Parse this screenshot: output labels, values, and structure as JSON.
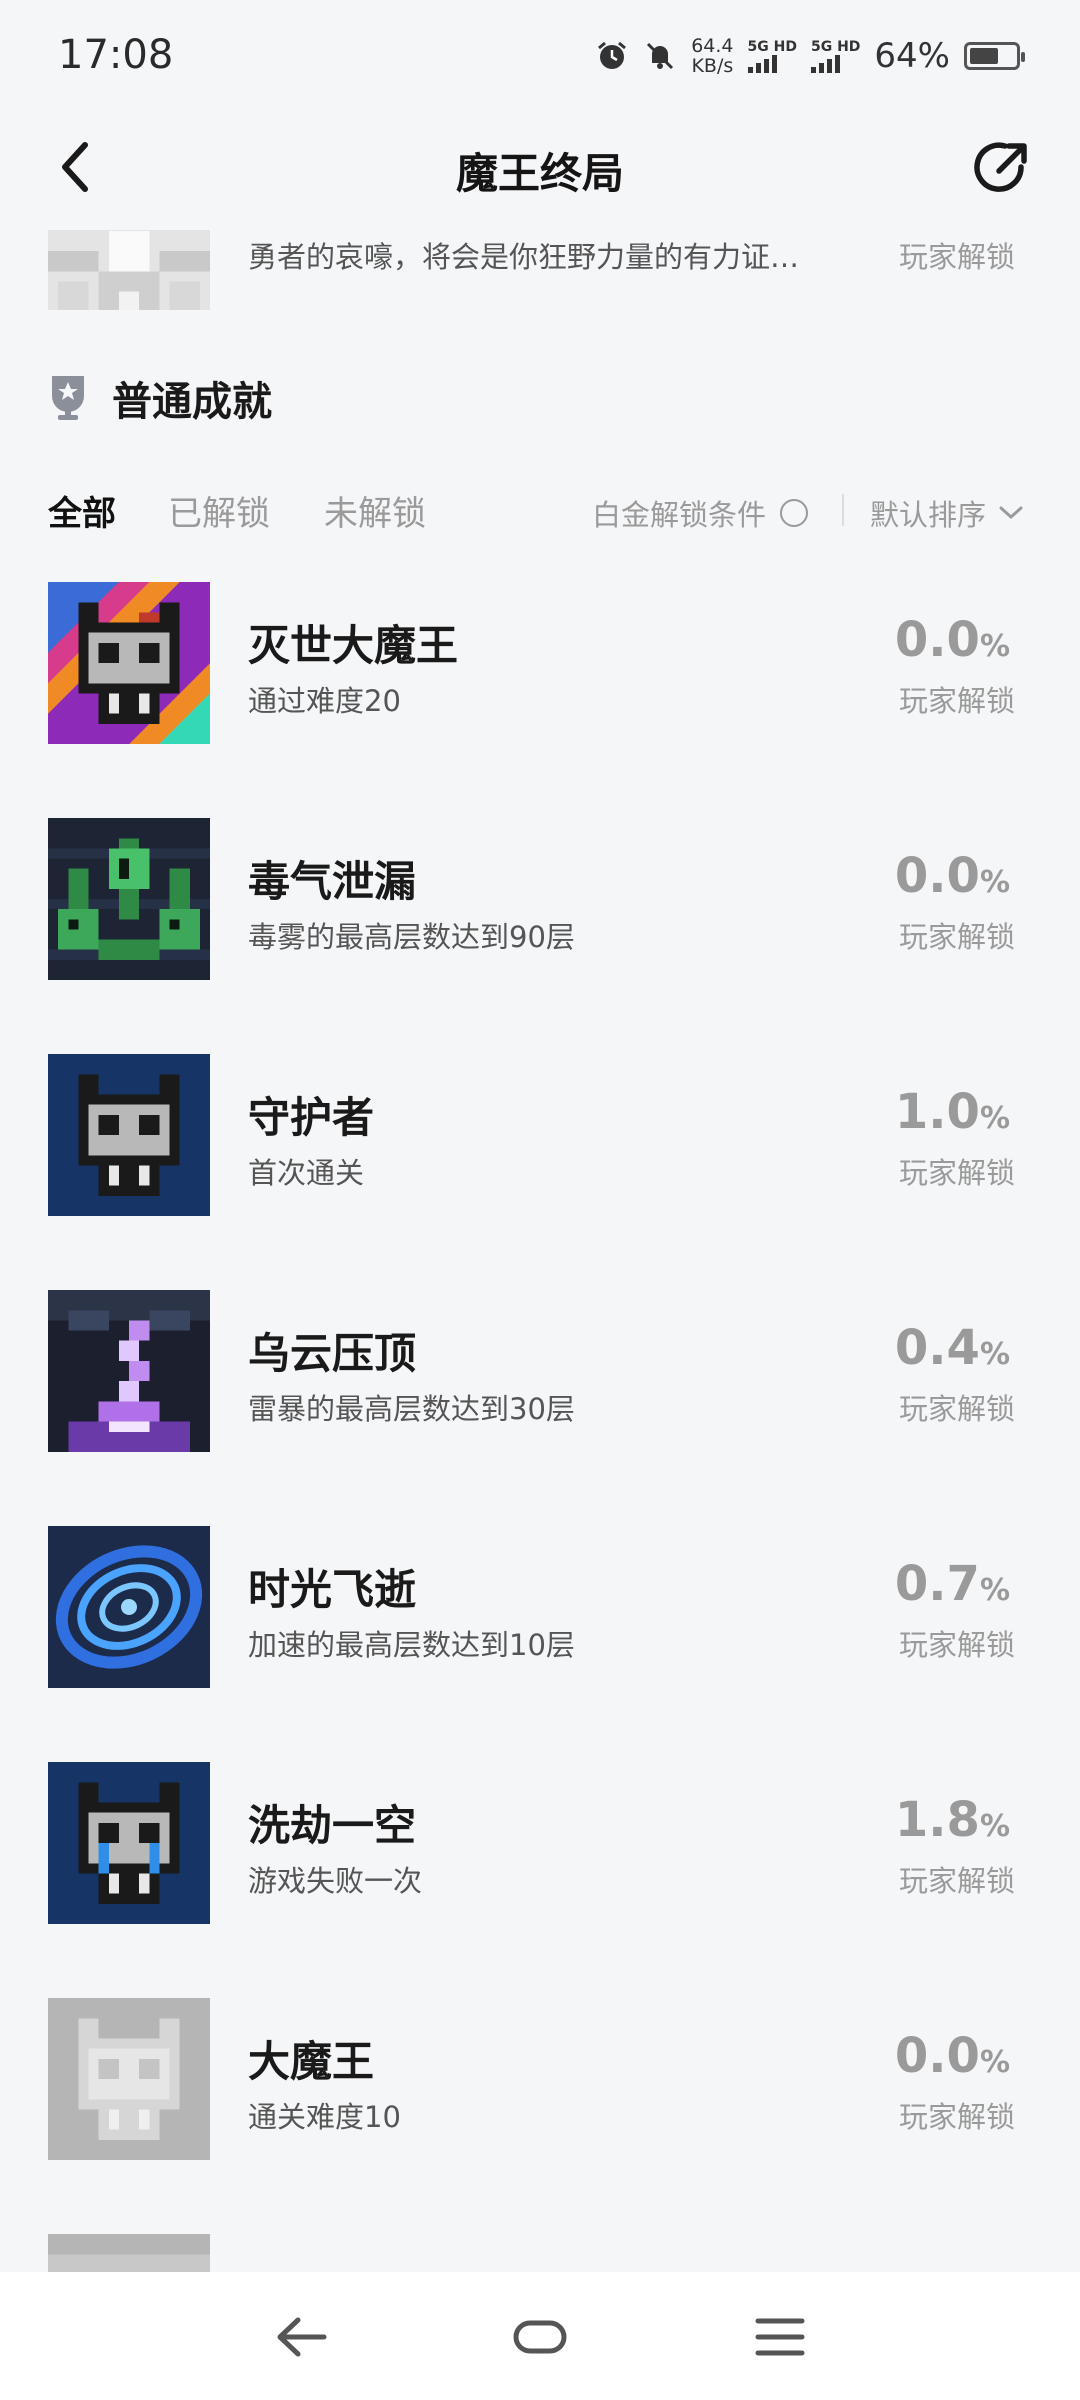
{
  "status_bar": {
    "time": "17:08",
    "net_speed_value": "64.4",
    "net_speed_unit": "KB/s",
    "sim1": "5G HD",
    "sim2": "5G HD",
    "battery": "64%",
    "battery_level": 0.64
  },
  "header": {
    "title": "魔王终局"
  },
  "partial_item": {
    "description": "勇者的哀嚎，将会是你狂野力量的有力证…",
    "status": "玩家解锁"
  },
  "section": {
    "title": "普通成就"
  },
  "filters": {
    "tabs": [
      "全部",
      "已解锁",
      "未解锁"
    ],
    "active_tab": "全部",
    "platinum_condition": "白金解锁条件",
    "sort": "默认排序"
  },
  "achievements": [
    {
      "name": "灭世大魔王",
      "description": "通过难度20",
      "percent": "0.0",
      "unit": "%",
      "status": "玩家解锁",
      "icon": "skull-rainbow-icon"
    },
    {
      "name": "毒气泄漏",
      "description": "毒雾的最高层数达到90层",
      "percent": "0.0",
      "unit": "%",
      "status": "玩家解锁",
      "icon": "poison-tentacles-icon"
    },
    {
      "name": "守护者",
      "description": "首次通关",
      "percent": "1.0",
      "unit": "%",
      "status": "玩家解锁",
      "icon": "skull-blue-icon"
    },
    {
      "name": "乌云压顶",
      "description": "雷暴的最高层数达到30层",
      "percent": "0.4",
      "unit": "%",
      "status": "玩家解锁",
      "icon": "lightning-storm-icon"
    },
    {
      "name": "时光飞逝",
      "description": "加速的最高层数达到10层",
      "percent": "0.7",
      "unit": "%",
      "status": "玩家解锁",
      "icon": "time-vortex-icon"
    },
    {
      "name": "洗劫一空",
      "description": "游戏失败一次",
      "percent": "1.8",
      "unit": "%",
      "status": "玩家解锁",
      "icon": "skull-crying-icon"
    },
    {
      "name": "大魔王",
      "description": "通关难度10",
      "percent": "0.0",
      "unit": "%",
      "status": "玩家解锁",
      "icon": "skull-grey-locked-icon"
    }
  ],
  "colors": {
    "background": "#f5f6f8",
    "text_primary": "#1a1a1a",
    "text_secondary": "#555555",
    "text_muted": "#9a9a9a",
    "icon_blue": "#173466"
  }
}
